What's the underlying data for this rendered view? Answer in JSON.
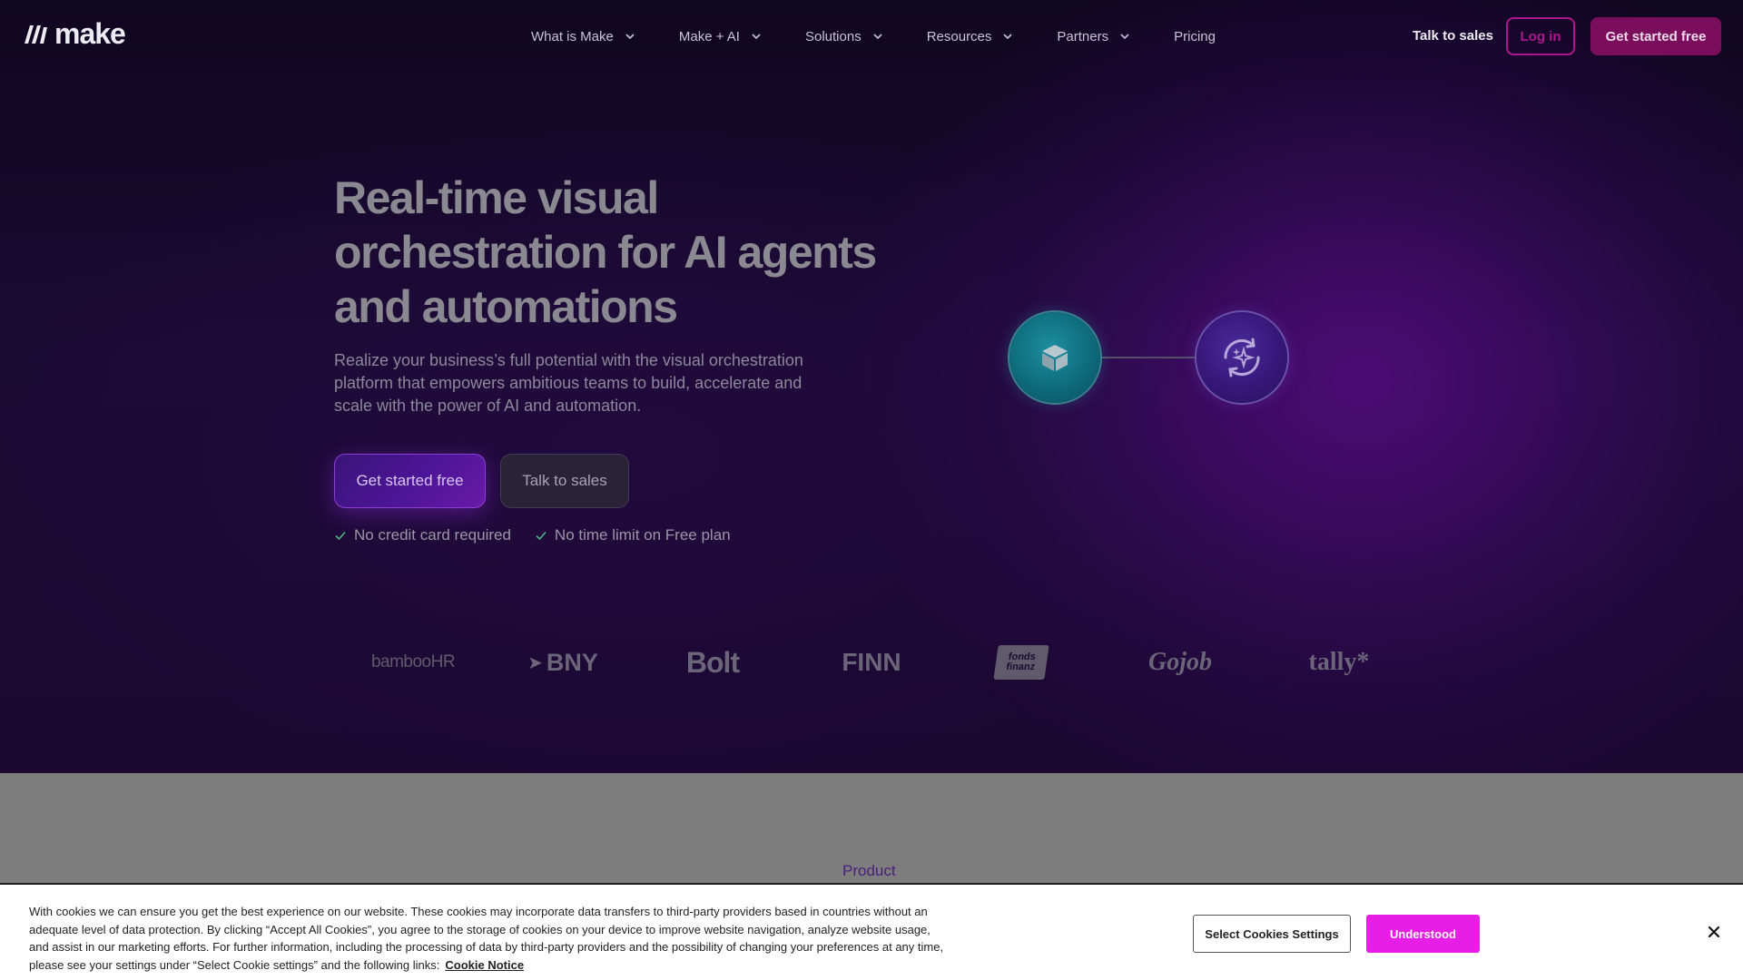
{
  "colors": {
    "brand_magenta": "#b0168f",
    "header_cta_bg": "#7a0e5c",
    "accept_button": "#e61ee6",
    "hero_bg": "#1a0b33",
    "node_teal": "#0e6b7c",
    "node_purple": "#36187a"
  },
  "header": {
    "logo_text": "make",
    "nav": [
      {
        "label": "What is Make",
        "has_dropdown": true
      },
      {
        "label": "Make + AI",
        "has_dropdown": true
      },
      {
        "label": "Solutions",
        "has_dropdown": true
      },
      {
        "label": "Resources",
        "has_dropdown": true
      },
      {
        "label": "Partners",
        "has_dropdown": true
      },
      {
        "label": "Pricing",
        "has_dropdown": false
      }
    ],
    "talk_to_sales": "Talk to sales",
    "login": "Log in",
    "cta": "Get started free"
  },
  "hero": {
    "headline": "Real-time visual orchestration for AI agents and automations",
    "subcopy": "Realize your business’s full potential with the visual orchestration platform that empowers ambitious teams to build, accelerate and scale with the power of AI and automation.",
    "primary_cta": "Get started free",
    "secondary_cta": "Talk to sales",
    "benefits": [
      "No credit card required",
      "No time limit on Free plan"
    ],
    "diagram_icons": [
      "box-icon",
      "sparkle-refresh-icon"
    ]
  },
  "clients": [
    {
      "name": "bamboohr",
      "display": "bambooHR"
    },
    {
      "name": "bny",
      "display": "BNY"
    },
    {
      "name": "bolt",
      "display": "Bolt"
    },
    {
      "name": "finn",
      "display": "FINN"
    },
    {
      "name": "fondsfinanz",
      "display": "fonds finanz"
    },
    {
      "name": "gojob",
      "display": "Gojob"
    },
    {
      "name": "tally",
      "display": "tally*"
    }
  ],
  "section": {
    "label": "Product"
  },
  "cookie_banner": {
    "text": "With cookies we can ensure you get the best experience on our website. These cookies may incorporate data transfers to third-party providers based in countries without an adequate level of data protection. By clicking “Accept All Cookies”, you agree to the storage of cookies on your device to improve website navigation, analyze website usage, and assist in our marketing efforts. For further information, including the processing of data by third-party providers and the possibility of changing your preferences at any time, please see your settings under “Select Cookie settings” and the following links:",
    "link": "Cookie Notice",
    "settings_button": "Select Cookies Settings",
    "accept_button": "Understood"
  }
}
